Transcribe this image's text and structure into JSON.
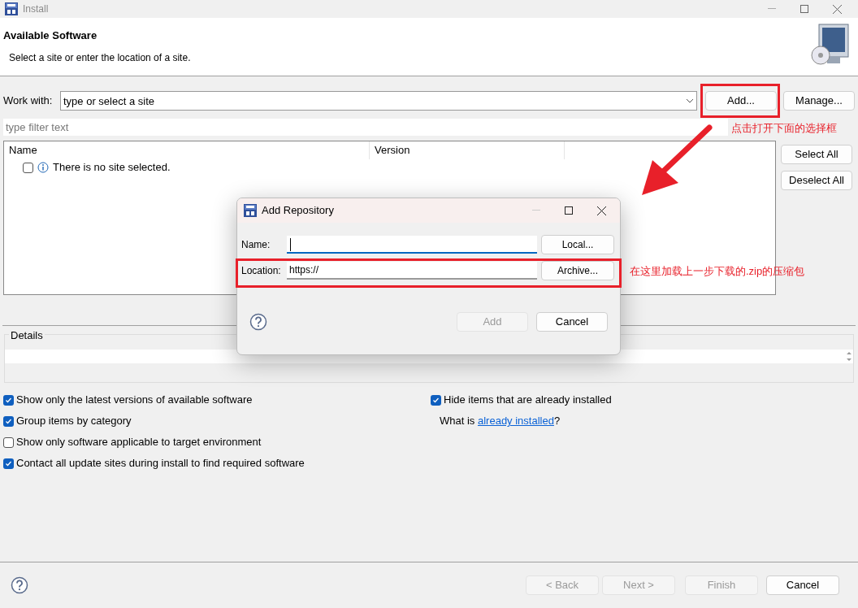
{
  "window": {
    "title": "Install"
  },
  "header": {
    "title": "Available Software",
    "subtitle": "Select a site or enter the location of a site."
  },
  "work_with": {
    "label": "Work with:",
    "placeholder": "type or select a site"
  },
  "side_buttons": [
    {
      "label": "Add...",
      "disabled": false
    },
    {
      "label": "Manage...",
      "disabled": false
    }
  ],
  "filter": {
    "placeholder": "type filter text"
  },
  "list_buttons": [
    {
      "label": "Select All",
      "disabled": false
    },
    {
      "label": "Deselect All",
      "disabled": false
    }
  ],
  "table": {
    "columns": [
      "Name",
      "Version"
    ],
    "rows": [
      {
        "text": "There is no site selected.",
        "checked": false
      }
    ]
  },
  "details": {
    "label": "Details"
  },
  "options_left": [
    {
      "label": "Show only the latest versions of available software",
      "checked": true
    },
    {
      "label": "Group items by category",
      "checked": true
    },
    {
      "label": "Show only software applicable to target environment",
      "checked": false
    },
    {
      "label": "Contact all update sites during install to find required software",
      "checked": true
    }
  ],
  "options_right": [
    {
      "label": "Hide items that are already installed",
      "checked": true
    }
  ],
  "installed_note": {
    "prefix": "What is ",
    "link": "already installed",
    "suffix": "?"
  },
  "wizard_buttons": [
    {
      "label": "< Back",
      "disabled": true
    },
    {
      "label": "Next >",
      "disabled": true
    },
    {
      "label": "Finish",
      "disabled": true
    },
    {
      "label": "Cancel",
      "disabled": false
    }
  ],
  "dialog": {
    "title": "Add Repository",
    "fields": [
      {
        "label": "Name:",
        "focused": true,
        "button": "Local..."
      },
      {
        "label": "Location:",
        "value": "https://",
        "focused": false,
        "button": "Archive..."
      }
    ],
    "buttons": [
      {
        "label": "Add",
        "disabled": true
      },
      {
        "label": "Cancel",
        "disabled": false
      }
    ]
  },
  "annotations": [
    {
      "text": "点击打开下面的选择框"
    },
    {
      "text": "在这里加载上一步下载的.zip的压缩包"
    }
  ]
}
